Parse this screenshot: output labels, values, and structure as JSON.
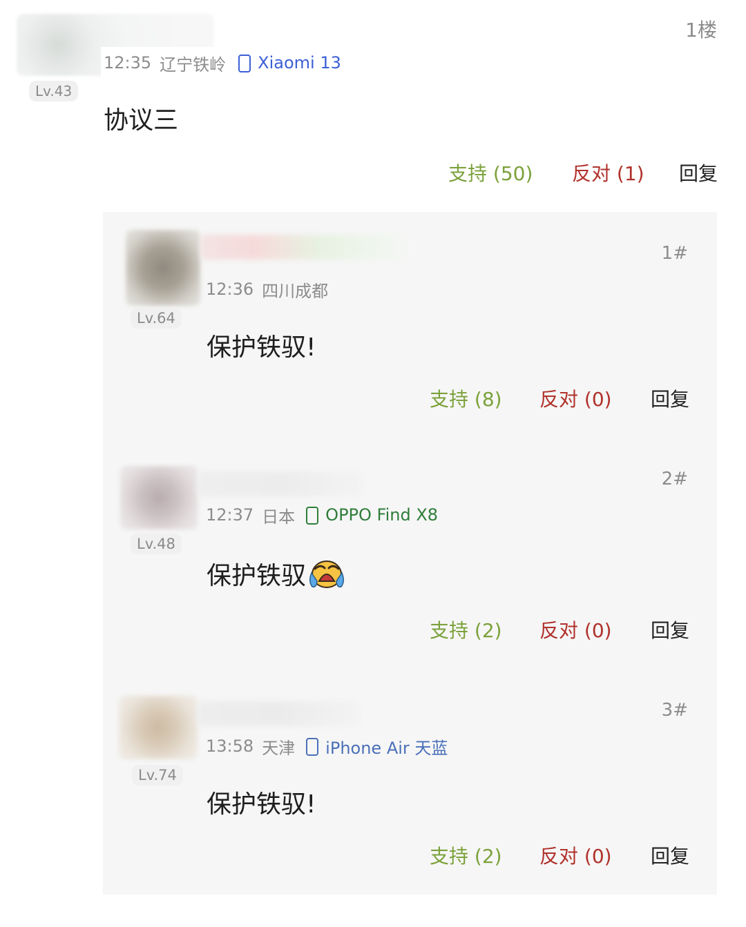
{
  "colors": {
    "support": "#7ba13b",
    "oppose": "#b0322b",
    "device_blue": "#3b5fd6",
    "device_green": "#2f7d3a",
    "device_steel": "#4a70b8",
    "meta_grey": "#8c8c8c",
    "panel_bg": "#f6f6f6"
  },
  "post": {
    "floor": "1楼",
    "level": "Lv.43",
    "time": "12:35",
    "location": "辽宁铁岭",
    "device_icon": "phone-icon",
    "device": "Xiaomi 13",
    "content": "协议三",
    "actions": {
      "support": "支持 (50)",
      "oppose": "反对 (1)",
      "reply": "回复"
    }
  },
  "replies": [
    {
      "floor": "1#",
      "level": "Lv.64",
      "time": "12:36",
      "location": "四川成都",
      "device": "",
      "content": "保护铁驭!",
      "actions": {
        "support": "支持 (8)",
        "oppose": "反对 (0)",
        "reply": "回复"
      }
    },
    {
      "floor": "2#",
      "level": "Lv.48",
      "time": "12:37",
      "location": "日本",
      "device_icon": "phone-icon",
      "device": "OPPO Find X8",
      "content": "保护铁驭",
      "emoji_icon": "crying-face-icon",
      "actions": {
        "support": "支持 (2)",
        "oppose": "反对 (0)",
        "reply": "回复"
      }
    },
    {
      "floor": "3#",
      "level": "Lv.74",
      "time": "13:58",
      "location": "天津",
      "device_icon": "phone-icon",
      "device": "iPhone Air 天蓝",
      "content": "保护铁驭!",
      "actions": {
        "support": "支持 (2)",
        "oppose": "反对 (0)",
        "reply": "回复"
      }
    }
  ]
}
